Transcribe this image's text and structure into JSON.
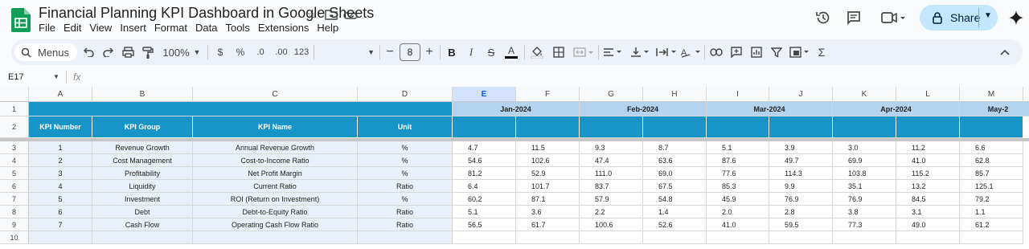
{
  "doc": {
    "title": "Financial Planning KPI Dashboard in Google Sheets"
  },
  "menu": [
    "File",
    "Edit",
    "View",
    "Insert",
    "Format",
    "Data",
    "Tools",
    "Extensions",
    "Help"
  ],
  "share": {
    "label": "Share"
  },
  "toolbar": {
    "search_label": "Menus",
    "zoom": "100%",
    "currency": "$",
    "percent": "%",
    "dec_decrease": ".0",
    "dec_increase": ".00",
    "number_format": "123",
    "font_size": "8",
    "bold": "B"
  },
  "formula_bar": {
    "name_box": "E17",
    "fx": "fx"
  },
  "columns": [
    "A",
    "B",
    "C",
    "D",
    "E",
    "F",
    "G",
    "H",
    "I",
    "J",
    "K",
    "L",
    "M"
  ],
  "row_numbers": [
    "1",
    "2",
    "3",
    "4",
    "5",
    "6",
    "7",
    "8",
    "9",
    "10"
  ],
  "headers": [
    "KPI Number",
    "KPI Group",
    "KPI Name",
    "Unit"
  ],
  "months": [
    "Jan-2024",
    "Feb-2024",
    "Mar-2024",
    "Apr-2024",
    "May-2"
  ],
  "rows": [
    {
      "num": "1",
      "group": "Revenue Growth",
      "name": "Annual Revenue Growth",
      "unit": "%",
      "values": [
        "4.7",
        "11.5",
        "9.3",
        "8.7",
        "5.1",
        "3.9",
        "3.0",
        "11.2",
        "6.6"
      ]
    },
    {
      "num": "2",
      "group": "Cost Management",
      "name": "Cost-to-Income Ratio",
      "unit": "%",
      "values": [
        "54.6",
        "102.6",
        "47.4",
        "63.6",
        "87.6",
        "49.7",
        "69.9",
        "41.0",
        "62.8"
      ]
    },
    {
      "num": "3",
      "group": "Profitability",
      "name": "Net Profit Margin",
      "unit": "%",
      "values": [
        "81.2",
        "52.9",
        "111.0",
        "69.0",
        "77.6",
        "114.3",
        "103.8",
        "115.2",
        "85.7"
      ]
    },
    {
      "num": "4",
      "group": "Liquidity",
      "name": "Current Ratio",
      "unit": "Ratio",
      "values": [
        "6.4",
        "101.7",
        "83.7",
        "67.5",
        "85.3",
        "9.9",
        "35.1",
        "13.2",
        "125.1"
      ]
    },
    {
      "num": "5",
      "group": "Investment",
      "name": "ROI (Return on Investment)",
      "unit": "%",
      "values": [
        "60.2",
        "87.1",
        "57.9",
        "54.8",
        "45.9",
        "76.9",
        "76.9",
        "84.5",
        "79.2"
      ]
    },
    {
      "num": "6",
      "group": "Debt",
      "name": "Debt-to-Equity Ratio",
      "unit": "Ratio",
      "values": [
        "5.1",
        "3.6",
        "2.2",
        "1.4",
        "2.0",
        "2.8",
        "3.8",
        "3.1",
        "1.1"
      ]
    },
    {
      "num": "7",
      "group": "Cash Flow",
      "name": "Operating Cash Flow Ratio",
      "unit": "Ratio",
      "values": [
        "56.5",
        "61.7",
        "100.6",
        "52.6",
        "41.0",
        "59.5",
        "77.3",
        "49.0",
        "61.2"
      ]
    }
  ],
  "colors": {
    "header_blue": "#1795c9",
    "month_blue": "#b4d3ee",
    "share_bg": "#c2e7ff",
    "left_cell_bg": "#e8f0fa"
  }
}
